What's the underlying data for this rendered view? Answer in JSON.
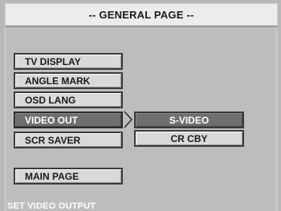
{
  "header": {
    "title": "-- GENERAL PAGE --"
  },
  "menu": {
    "items": [
      {
        "label": "TV DISPLAY"
      },
      {
        "label": "ANGLE MARK"
      },
      {
        "label": "OSD LANG"
      },
      {
        "label": "VIDEO OUT"
      },
      {
        "label": "SCR SAVER"
      }
    ],
    "selected": "VIDEO OUT",
    "main_page": "MAIN PAGE"
  },
  "submenu": {
    "options": [
      {
        "label": "S-VIDEO"
      },
      {
        "label": "CR CBY"
      }
    ],
    "selected": "S-VIDEO"
  },
  "status": {
    "text": "SET VIDEO OUTPUT"
  },
  "colors": {
    "background": "#b8b8b8",
    "header_bg": "#ececec",
    "button_bg": "#d9d9d9",
    "highlight_bg": "#6f6f6f",
    "highlight_text": "#ffffff"
  }
}
